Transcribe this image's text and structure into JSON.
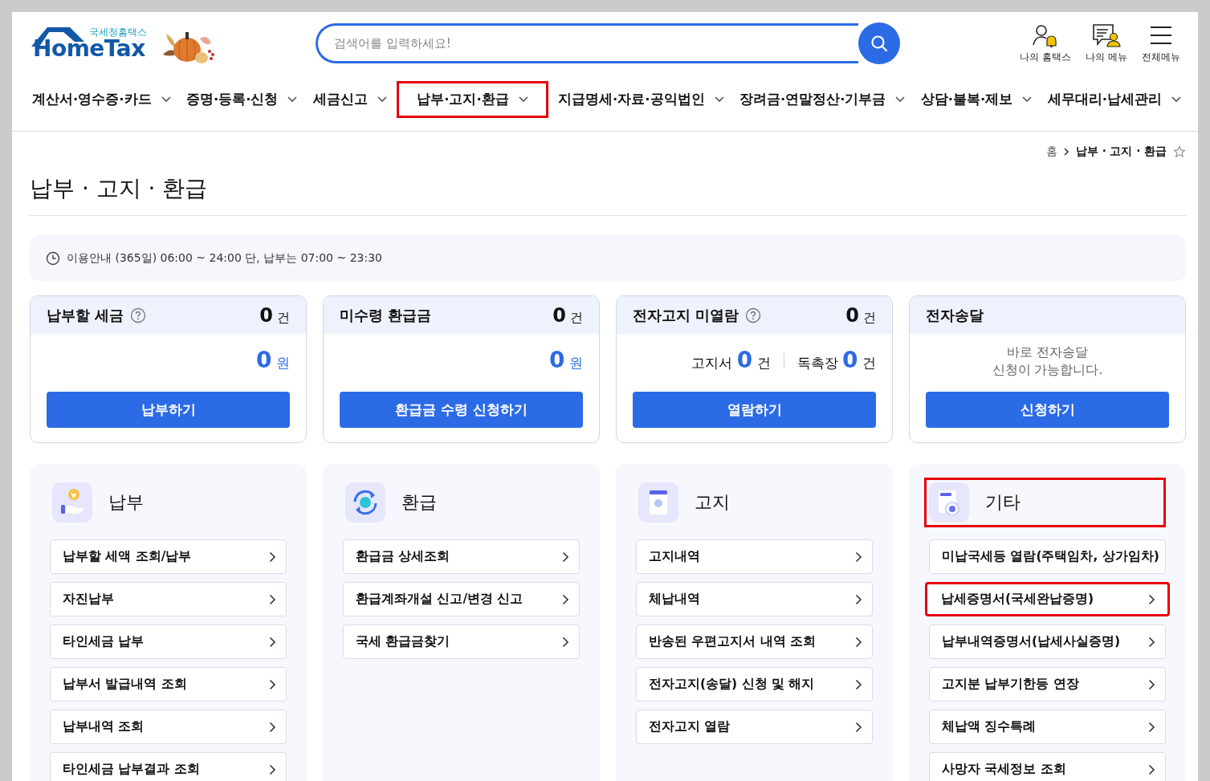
{
  "logo": {
    "subtitle": "국세청홈택스",
    "name": "HomeTax"
  },
  "search": {
    "placeholder": "검색어를 입력하세요!"
  },
  "utility_links": [
    {
      "kind": "my-hometax",
      "label": "나의 홈택스"
    },
    {
      "kind": "my-menu",
      "label": "나의 메뉴"
    },
    {
      "kind": "all-menu",
      "label": "전체메뉴"
    }
  ],
  "nav": [
    {
      "label": "계산서·영수증·카드",
      "highlighted": false
    },
    {
      "label": "증명·등록·신청",
      "highlighted": false
    },
    {
      "label": "세금신고",
      "highlighted": false
    },
    {
      "label": "납부·고지·환급",
      "highlighted": true
    },
    {
      "label": "지급명세·자료·공익법인",
      "highlighted": false
    },
    {
      "label": "장려금·연말정산·기부금",
      "highlighted": false
    },
    {
      "label": "상담·불복·제보",
      "highlighted": false
    },
    {
      "label": "세무대리·납세관리",
      "highlighted": false
    }
  ],
  "breadcrumb": [
    "홈",
    "납부 · 고지 · 환급"
  ],
  "page_title": "납부 · 고지 · 환급",
  "notice": "이용안내 (365일) 06:00 ~ 24:00 단, 납부는 07:00 ~ 23:30",
  "summary_cards": [
    {
      "kind": "amount",
      "title": "납부할 세금",
      "help": true,
      "count": "0",
      "count_unit": "건",
      "amount": "0",
      "amount_unit": "원",
      "button": "납부하기"
    },
    {
      "kind": "amount",
      "title": "미수령 환급금",
      "help": false,
      "count": "0",
      "count_unit": "건",
      "amount": "0",
      "amount_unit": "원",
      "button": "환급금 수령 신청하기"
    },
    {
      "kind": "split",
      "title": "전자고지 미열람",
      "help": true,
      "count": "0",
      "count_unit": "건",
      "parts": [
        {
          "label": "고지서",
          "value": "0",
          "unit": "건"
        },
        {
          "label": "독촉장",
          "value": "0",
          "unit": "건"
        }
      ],
      "button": "열람하기"
    },
    {
      "kind": "message",
      "title": "전자송달",
      "message": "바로 전자송달\n신청이 가능합니다.",
      "button": "신청하기"
    }
  ],
  "panels": [
    {
      "kind": "payment",
      "title": "납부",
      "highlighted": false,
      "items": [
        {
          "label": "납부할 세액 조회/납부",
          "highlighted": false
        },
        {
          "label": "자진납부",
          "highlighted": false
        },
        {
          "label": "타인세금 납부",
          "highlighted": false
        },
        {
          "label": "납부서 발급내역 조회",
          "highlighted": false
        },
        {
          "label": "납부내역 조회",
          "highlighted": false
        },
        {
          "label": "타인세금 납부결과 조회",
          "highlighted": false
        }
      ]
    },
    {
      "kind": "refund",
      "title": "환급",
      "highlighted": false,
      "items": [
        {
          "label": "환급금 상세조회",
          "highlighted": false
        },
        {
          "label": "환급계좌개설 신고/변경 신고",
          "highlighted": false
        },
        {
          "label": "국세 환급금찾기",
          "highlighted": false
        }
      ]
    },
    {
      "kind": "notice",
      "title": "고지",
      "highlighted": false,
      "items": [
        {
          "label": "고지내역",
          "highlighted": false
        },
        {
          "label": "체납내역",
          "highlighted": false
        },
        {
          "label": "반송된 우편고지서 내역 조회",
          "highlighted": false
        },
        {
          "label": "전자고지(송달) 신청 및 해지",
          "highlighted": false
        },
        {
          "label": "전자고지 열람",
          "highlighted": false
        }
      ]
    },
    {
      "kind": "other",
      "title": "기타",
      "highlighted": true,
      "items": [
        {
          "label": "미납국세등 열람(주택임차, 상가임차)",
          "highlighted": false
        },
        {
          "label": "납세증명서(국세완납증명)",
          "highlighted": true
        },
        {
          "label": "납부내역증명서(납세사실증명)",
          "highlighted": false
        },
        {
          "label": "고지분 납부기한등 연장",
          "highlighted": false
        },
        {
          "label": "체납액 징수특례",
          "highlighted": false
        },
        {
          "label": "사망자 국세정보 조회",
          "highlighted": false
        }
      ]
    }
  ]
}
